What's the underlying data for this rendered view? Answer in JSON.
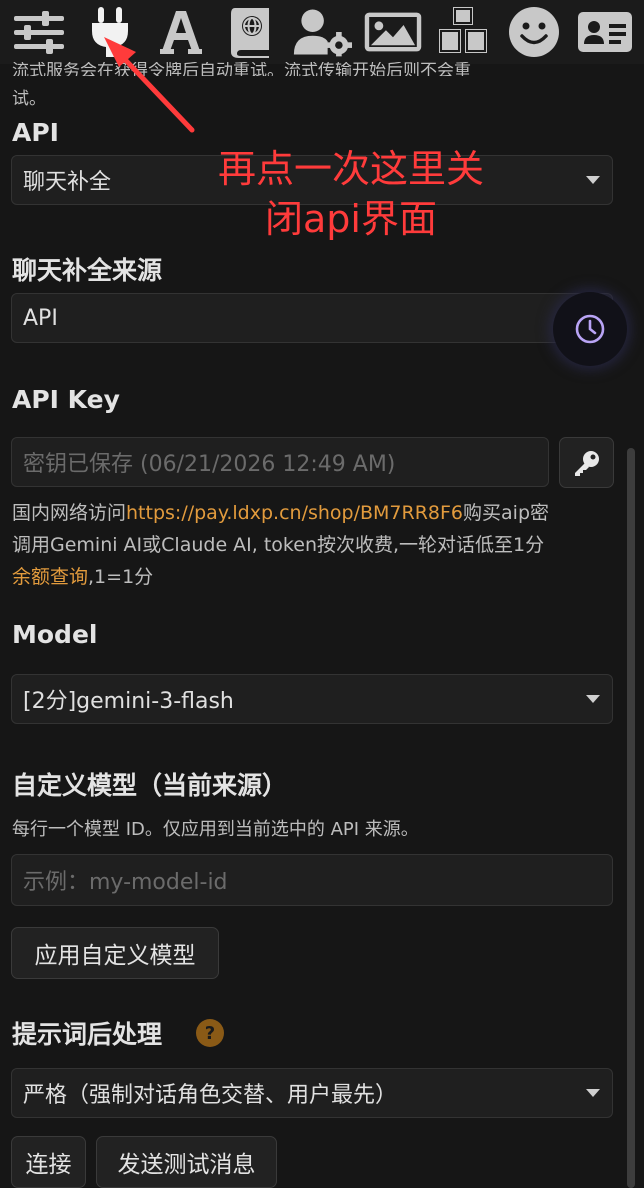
{
  "toolbar": {
    "icons": [
      "sliders-icon",
      "plug-icon",
      "font-icon",
      "book-globe-icon",
      "user-gear-icon",
      "image-icon",
      "cubes-icon",
      "smiley-icon",
      "id-card-icon"
    ]
  },
  "clipped_line_top": "流式服务会在获得令牌后自动重试。流式传输开始后则不会重",
  "clipped_line_rest": "试。",
  "api": {
    "label": "API",
    "selected": "聊天补全"
  },
  "source": {
    "label": "聊天补全来源",
    "selected": "API"
  },
  "api_key": {
    "label": "API Key",
    "placeholder": "密钥已保存 (06/21/2026 12:49 AM)"
  },
  "info": {
    "line1_prefix": "国内网络访问",
    "line1_link": "https://pay.ldxp.cn/shop/BM7RR8F6",
    "line1_suffix": "购买aip密",
    "line2": "调用Gemini AI或Claude AI, token按次收费,一轮对话低至1分",
    "line3_link": "余额查询",
    "line3_suffix": ",1=1分"
  },
  "model": {
    "label": "Model",
    "selected": "[2分]gemini-3-flash"
  },
  "custom_model": {
    "label": "自定义模型（当前来源）",
    "desc": "每行一个模型 ID。仅应用到当前选中的 API 来源。",
    "placeholder": "示例：my-model-id",
    "apply_button": "应用自定义模型"
  },
  "postprocess": {
    "label": "提示词后处理",
    "help": "?",
    "selected": "严格（强制对话角色交替、用户最先）"
  },
  "buttons": {
    "connect": "连接",
    "send_test": "发送测试消息"
  },
  "annotation": {
    "line1": "再点一次这里关",
    "line2": "闭api界面"
  },
  "colors": {
    "accent_link": "#e29b3d",
    "annotation_red": "#ff3b3b",
    "clock_purple": "#b9a4f5"
  }
}
